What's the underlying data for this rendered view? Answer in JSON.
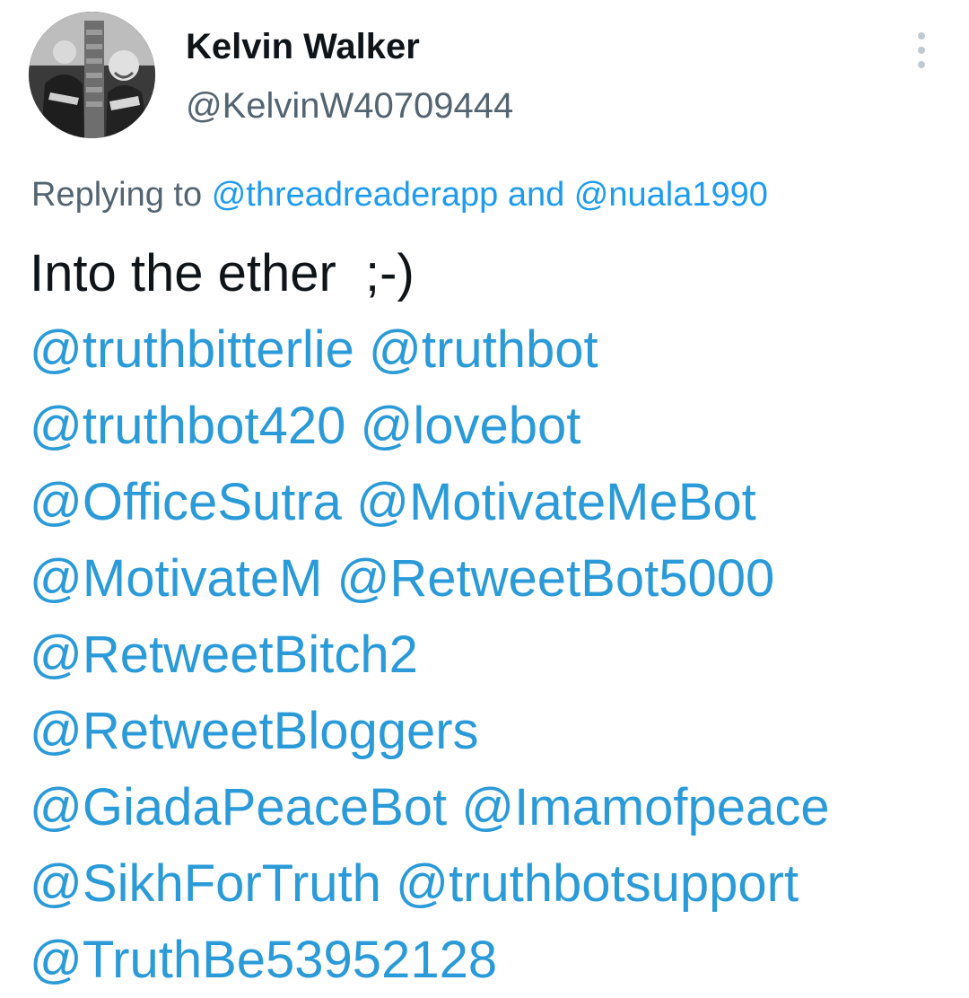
{
  "tweet": {
    "author": {
      "display_name": "Kelvin Walker",
      "handle": "@KelvinW40709444"
    },
    "more_icon": "more-vertical-icon",
    "replying": {
      "prefix": "Replying to",
      "mention_1": "@threadreaderapp",
      "conjunction": "and",
      "mention_2": "@nuala1990"
    },
    "text": "Into the ether  ;-)",
    "mention_lines": [
      [
        "@truthbitterlie",
        "@truthbot"
      ],
      [
        "@truthbot420",
        "@lovebot"
      ],
      [
        "@OfficeSutra",
        "@MotivateMeBot"
      ],
      [
        "@MotivateM",
        "@RetweetBot5000"
      ],
      [
        "@RetweetBitch2"
      ],
      [
        "@RetweetBloggers"
      ],
      [
        "@GiadaPeaceBot",
        "@Imamofpeace"
      ],
      [
        "@SikhForTruth",
        "@truthbotsupport"
      ],
      [
        "@TruthBe53952128"
      ]
    ],
    "colors": {
      "text": "#0f1419",
      "secondary": "#536471",
      "link": "#2b9ad8",
      "background": "#ffffff"
    }
  }
}
